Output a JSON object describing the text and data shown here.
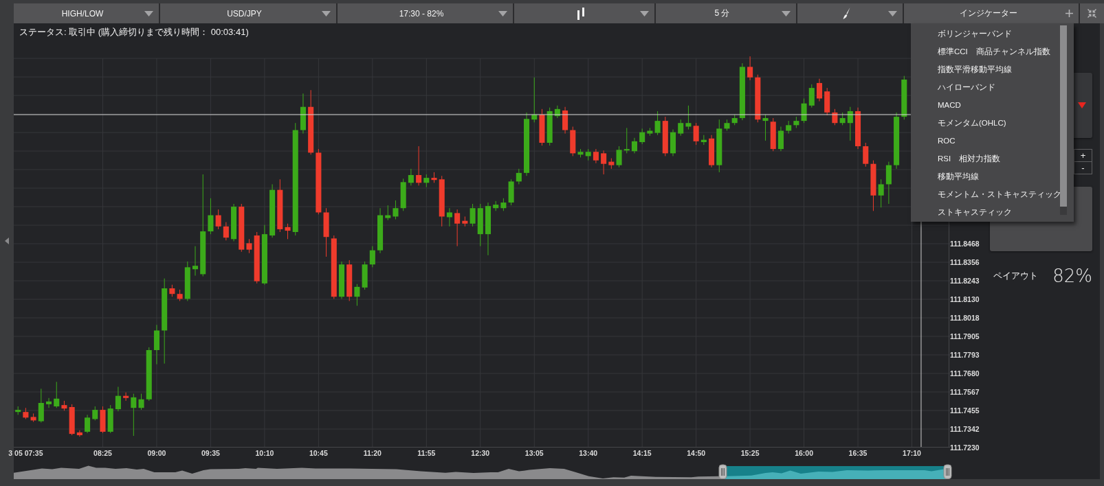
{
  "toolbar": {
    "items": [
      {
        "kind": "select",
        "label": "HIGH/LOW"
      },
      {
        "kind": "select",
        "label": "USD/JPY"
      },
      {
        "kind": "select",
        "label": "17:30 - 82%"
      },
      {
        "kind": "chart_type"
      },
      {
        "kind": "select",
        "label": "5 分"
      },
      {
        "kind": "drawing_tool"
      },
      {
        "kind": "indicators",
        "label": "インジケーター",
        "expanded": true,
        "menu": [
          "ボリンジャーバンド",
          "標準CCI　商品チャンネル指数",
          "指数平滑移動平均線",
          "ハイローバンド",
          "MACD",
          "モメンタム(OHLC)",
          "ROC",
          "RSI　相対力指数",
          "移動平均線",
          "モメントム・ストキャスティック",
          "ストキャスティック"
        ]
      }
    ]
  },
  "status": "ステータス: 取引中 (購入締切りまで残り時間： 00:03:41)",
  "chart": {
    "chart_data": {
      "type": "candlestick",
      "grid": true,
      "x": [
        450,
        455,
        460,
        465,
        470,
        475,
        480,
        485,
        490,
        495,
        500,
        505,
        510,
        515,
        520,
        525,
        530,
        535,
        540,
        545,
        550,
        555,
        560,
        565,
        570,
        575,
        580,
        585,
        590,
        595,
        600,
        605,
        610,
        615,
        620,
        625,
        630,
        635,
        640,
        645,
        650,
        655,
        660,
        665,
        670,
        675,
        680,
        685,
        690,
        695,
        700,
        705,
        710,
        715,
        720,
        725,
        730,
        735,
        740,
        745,
        750,
        755,
        760,
        765,
        770,
        775,
        780,
        785,
        790,
        795,
        800,
        805,
        810,
        815,
        820,
        825,
        830,
        835,
        840,
        845,
        850,
        855,
        860,
        865,
        870,
        875,
        880,
        885,
        890,
        895,
        900,
        905,
        910,
        915,
        920,
        925,
        930,
        935,
        940,
        945,
        950,
        955,
        960,
        965,
        970,
        975,
        980,
        985,
        990,
        995,
        1000,
        1005,
        1010,
        1015,
        1020,
        1025
      ],
      "ohlc": [
        [
          111.7446,
          111.748,
          111.7429,
          111.7459
        ],
        [
          111.7446,
          111.7471,
          111.7403,
          111.7412
        ],
        [
          111.7416,
          111.7437,
          111.7386,
          111.7395
        ],
        [
          111.739,
          111.7587,
          111.7382,
          111.7501
        ],
        [
          111.7493,
          111.7531,
          111.7471,
          111.751
        ],
        [
          111.748,
          111.7629,
          111.7471,
          111.7527
        ],
        [
          111.7488,
          111.7514,
          111.7454,
          111.7467
        ],
        [
          111.7476,
          111.7493,
          111.7305,
          111.7313
        ],
        [
          111.7322,
          111.7335,
          111.7296,
          111.7305
        ],
        [
          111.7326,
          111.7429,
          111.7318,
          111.7412
        ],
        [
          111.7403,
          111.748,
          111.7395,
          111.7459
        ],
        [
          111.7459,
          111.748,
          111.7318,
          111.7326
        ],
        [
          111.7326,
          111.7488,
          111.7318,
          111.7467
        ],
        [
          111.7463,
          111.7599,
          111.745,
          111.7544
        ],
        [
          111.7544,
          111.7565,
          111.7514,
          111.7531
        ],
        [
          111.7471,
          111.7557,
          111.7301,
          111.7535
        ],
        [
          111.7471,
          111.7557,
          111.7459,
          111.7523
        ],
        [
          111.7523,
          111.7839,
          111.7514,
          111.7822
        ],
        [
          111.7822,
          111.7975,
          111.7736,
          111.7941
        ],
        [
          111.7941,
          111.8257,
          111.774,
          111.8197
        ],
        [
          111.8197,
          111.8219,
          111.8146,
          111.8163
        ],
        [
          111.8163,
          111.8189,
          111.812,
          111.8133
        ],
        [
          111.8133,
          111.836,
          111.812,
          111.8325
        ],
        [
          111.8313,
          111.8453,
          111.8274,
          111.8334
        ],
        [
          111.8283,
          111.8889,
          111.827,
          111.8543
        ],
        [
          111.8543,
          111.8744,
          111.8526,
          111.8641
        ],
        [
          111.8641,
          111.8676,
          111.8556,
          111.8573
        ],
        [
          111.8573,
          111.8599,
          111.8488,
          111.8505
        ],
        [
          111.8496,
          111.871,
          111.8483,
          111.8693
        ],
        [
          111.8693,
          111.871,
          111.8419,
          111.8432
        ],
        [
          111.8471,
          111.8496,
          111.8411,
          111.8432
        ],
        [
          111.8518,
          111.8539,
          111.8227,
          111.824
        ],
        [
          111.8227,
          111.8582,
          111.8219,
          111.8526
        ],
        [
          111.8518,
          111.8829,
          111.8505,
          111.8795
        ],
        [
          111.8795,
          111.8859,
          111.8539,
          111.8556
        ],
        [
          111.8569,
          111.859,
          111.8496,
          111.8547
        ],
        [
          111.8539,
          111.9201,
          111.8518,
          111.9158
        ],
        [
          111.9158,
          111.938,
          111.9137,
          111.9299
        ],
        [
          111.9299,
          111.9401,
          111.9009,
          111.9021
        ],
        [
          111.9021,
          111.9043,
          111.8646,
          111.8658
        ],
        [
          111.8658,
          111.8684,
          111.8389,
          111.8509
        ],
        [
          111.85,
          111.8518,
          111.8133,
          111.8146
        ],
        [
          111.8146,
          111.836,
          111.8133,
          111.8342
        ],
        [
          111.8342,
          111.8368,
          111.812,
          111.8146
        ],
        [
          111.8146,
          111.8223,
          111.8091,
          111.8206
        ],
        [
          111.8202,
          111.836,
          111.8189,
          111.8342
        ],
        [
          111.8342,
          111.8453,
          111.8325,
          111.8428
        ],
        [
          111.8428,
          111.8684,
          111.8411,
          111.8641
        ],
        [
          111.8624,
          111.8701,
          111.8611,
          111.8641
        ],
        [
          111.8633,
          111.8731,
          111.8616,
          111.8684
        ],
        [
          111.8684,
          111.8863,
          111.8667,
          111.8842
        ],
        [
          111.8838,
          111.8923,
          111.8821,
          111.8885
        ],
        [
          111.8885,
          111.906,
          111.8821,
          111.8838
        ],
        [
          111.8838,
          111.8889,
          111.8812,
          111.8868
        ],
        [
          111.8868,
          111.8902,
          111.8838,
          111.8855
        ],
        [
          111.8859,
          111.888,
          111.8573,
          111.8633
        ],
        [
          111.8629,
          111.8684,
          111.8573,
          111.8658
        ],
        [
          111.8654,
          111.8676,
          111.8453,
          111.859
        ],
        [
          111.8607,
          111.8633,
          111.8573,
          111.859
        ],
        [
          111.859,
          111.871,
          111.8573,
          111.8684
        ],
        [
          111.8526,
          111.871,
          111.8453,
          111.8684
        ],
        [
          111.8526,
          111.8718,
          111.8398,
          111.8697
        ],
        [
          111.8684,
          111.8727,
          111.8667,
          111.8705
        ],
        [
          111.8684,
          111.8744,
          111.8667,
          111.8718
        ],
        [
          111.8718,
          111.8859,
          111.8701,
          111.8846
        ],
        [
          111.8846,
          111.8923,
          111.8829,
          111.8898
        ],
        [
          111.8898,
          111.9265,
          111.888,
          111.9226
        ],
        [
          111.9222,
          111.9478,
          111.9205,
          111.9252
        ],
        [
          111.9252,
          111.9286,
          111.9064,
          111.9081
        ],
        [
          111.9081,
          111.9295,
          111.9064,
          111.9273
        ],
        [
          111.9243,
          111.9307,
          111.9231,
          111.9286
        ],
        [
          111.9277,
          111.9299,
          111.9137,
          111.9158
        ],
        [
          111.9158,
          111.9179,
          111.9,
          111.9017
        ],
        [
          111.9009,
          111.9043,
          111.8992,
          111.9026
        ],
        [
          111.9,
          111.9043,
          111.8974,
          111.9026
        ],
        [
          111.9026,
          111.9043,
          111.8957,
          111.8974
        ],
        [
          111.9017,
          111.9034,
          111.8889,
          111.8953
        ],
        [
          111.8966,
          111.8987,
          111.8923,
          111.8945
        ],
        [
          111.8945,
          111.906,
          111.8932,
          111.9038
        ],
        [
          111.9034,
          111.9171,
          111.9017,
          111.9043
        ],
        [
          111.903,
          111.9111,
          111.9017,
          111.909
        ],
        [
          111.9085,
          111.9167,
          111.9073,
          111.9145
        ],
        [
          111.9137,
          111.9171,
          111.9124,
          111.9154
        ],
        [
          111.9141,
          111.9273,
          111.9128,
          111.9214
        ],
        [
          111.9214,
          111.9239,
          111.9,
          111.9017
        ],
        [
          111.9017,
          111.9162,
          111.9,
          111.9145
        ],
        [
          111.9137,
          111.9222,
          111.9124,
          111.9201
        ],
        [
          111.9179,
          111.9307,
          111.9162,
          111.9201
        ],
        [
          111.9184,
          111.9201,
          111.9068,
          111.909
        ],
        [
          111.9085,
          111.9128,
          111.9068,
          111.9099
        ],
        [
          111.9107,
          111.9128,
          111.8932,
          111.8945
        ],
        [
          111.8945,
          111.9222,
          111.8902,
          111.9167
        ],
        [
          111.9167,
          111.9222,
          111.9154,
          111.9201
        ],
        [
          111.9201,
          111.9252,
          111.9188,
          111.9231
        ],
        [
          111.9231,
          111.9564,
          111.9218,
          111.9542
        ],
        [
          111.9542,
          111.9606,
          111.9461,
          111.9478
        ],
        [
          111.9478,
          111.9495,
          111.9205,
          111.9222
        ],
        [
          111.9214,
          111.9252,
          111.9094,
          111.9231
        ],
        [
          111.9209,
          111.9231,
          111.903,
          111.9043
        ],
        [
          111.9043,
          111.9179,
          111.903,
          111.9154
        ],
        [
          111.9154,
          111.9214,
          111.9137,
          111.9188
        ],
        [
          111.9188,
          111.9239,
          111.9171,
          111.9214
        ],
        [
          111.9214,
          111.935,
          111.9201,
          111.932
        ],
        [
          111.9307,
          111.9436,
          111.9295,
          111.9414
        ],
        [
          111.9444,
          111.947,
          111.9333,
          111.935
        ],
        [
          111.9393,
          111.9414,
          111.9248,
          111.9265
        ],
        [
          111.9265,
          111.9286,
          111.9188,
          111.9201
        ],
        [
          111.9201,
          111.9265,
          111.9188,
          111.9231
        ],
        [
          111.9201,
          111.9299,
          111.9094,
          111.9273
        ],
        [
          111.9273,
          111.9295,
          111.9043,
          111.906
        ],
        [
          111.906,
          111.9081,
          111.8936,
          111.8953
        ],
        [
          111.8953,
          111.8974,
          111.8667,
          111.8761
        ],
        [
          111.8761,
          111.8859,
          111.8688,
          111.8829
        ],
        [
          111.8829,
          111.8966,
          111.871,
          111.8945
        ],
        [
          111.8945,
          111.9265,
          111.8923,
          111.9239
        ],
        [
          111.9239,
          111.9487,
          111.9222,
          111.9465
        ]
      ],
      "ref_lines": [
        {
          "axis": "y",
          "value": 111.9252
        },
        {
          "axis": "x",
          "value": 1036
        }
      ],
      "xlim": [
        447.24,
        1054.75
      ],
      "ylim": [
        111.723,
        111.9698
      ],
      "xticks": [
        {
          "value": 455,
          "label": "3 05 07:35"
        },
        {
          "value": 505,
          "label": "08:25"
        },
        {
          "value": 540,
          "label": "09:00"
        },
        {
          "value": 575,
          "label": "09:35"
        },
        {
          "value": 610,
          "label": "10:10"
        },
        {
          "value": 645,
          "label": "10:45"
        },
        {
          "value": 680,
          "label": "11:20"
        },
        {
          "value": 715,
          "label": "11:55"
        },
        {
          "value": 750,
          "label": "12:30"
        },
        {
          "value": 785,
          "label": "13:05"
        },
        {
          "value": 820,
          "label": "13:40"
        },
        {
          "value": 855,
          "label": "14:15"
        },
        {
          "value": 890,
          "label": "14:50"
        },
        {
          "value": 925,
          "label": "15:25"
        },
        {
          "value": 960,
          "label": "16:00"
        },
        {
          "value": 995,
          "label": "16:35"
        },
        {
          "value": 1030,
          "label": "17:10"
        }
      ],
      "yticks": [
        {
          "value": 111.723,
          "label": "111.7230"
        },
        {
          "value": 111.7342,
          "label": "111.7342"
        },
        {
          "value": 111.7455,
          "label": "111.7455"
        },
        {
          "value": 111.7567,
          "label": "111.7567"
        },
        {
          "value": 111.768,
          "label": "111.7680"
        },
        {
          "value": 111.7793,
          "label": "111.7793"
        },
        {
          "value": 111.7905,
          "label": "111.7905"
        },
        {
          "value": 111.8018,
          "label": "111.8018"
        },
        {
          "value": 111.813,
          "label": "111.8130"
        },
        {
          "value": 111.8243,
          "label": "111.8243"
        },
        {
          "value": 111.8356,
          "label": "111.8356"
        },
        {
          "value": 111.8468,
          "label": "111.8468"
        }
      ]
    }
  },
  "side_panel": {
    "stake_buttons": [
      "+",
      "-"
    ],
    "payout_label": "ペイアウト",
    "payout_value": "82%"
  }
}
